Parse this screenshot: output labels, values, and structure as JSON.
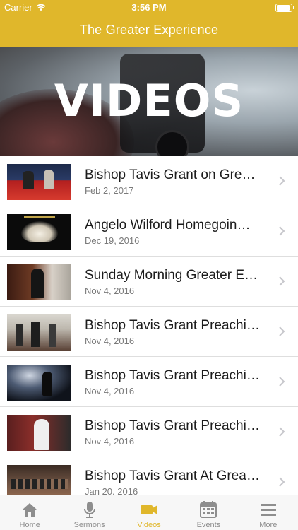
{
  "status_bar": {
    "carrier": "Carrier",
    "time": "3:56 PM",
    "battery_level": 0.95
  },
  "navbar": {
    "title": "The Greater Experience"
  },
  "banner": {
    "text": "VIDEOS"
  },
  "videos": [
    {
      "title": "Bishop Tavis Grant on Gre…",
      "date": "Feb 2, 2017"
    },
    {
      "title": "Angelo Wilford Homegoin…",
      "date": "Dec 19, 2016"
    },
    {
      "title": "Sunday Morning Greater E…",
      "date": "Nov 4, 2016"
    },
    {
      "title": "Bishop Tavis Grant Preachi…",
      "date": "Nov 4, 2016"
    },
    {
      "title": "Bishop Tavis Grant Preachi…",
      "date": "Nov 4, 2016"
    },
    {
      "title": "Bishop Tavis Grant Preachi…",
      "date": "Nov 4, 2016"
    },
    {
      "title": "Bishop Tavis Grant At Grea…",
      "date": "Jan 20, 2016"
    }
  ],
  "tabbar": {
    "active": "videos",
    "tabs": [
      {
        "label": "Home",
        "icon": "house-icon"
      },
      {
        "label": "Sermons",
        "icon": "microphone-icon"
      },
      {
        "label": "Videos",
        "icon": "video-camera-icon"
      },
      {
        "label": "Events",
        "icon": "calendar-icon"
      },
      {
        "label": "More",
        "icon": "menu-icon"
      }
    ]
  },
  "colors": {
    "accent": "#e0b72b",
    "tab_inactive": "#8e8e8e",
    "date_text": "#7a7a7a"
  }
}
